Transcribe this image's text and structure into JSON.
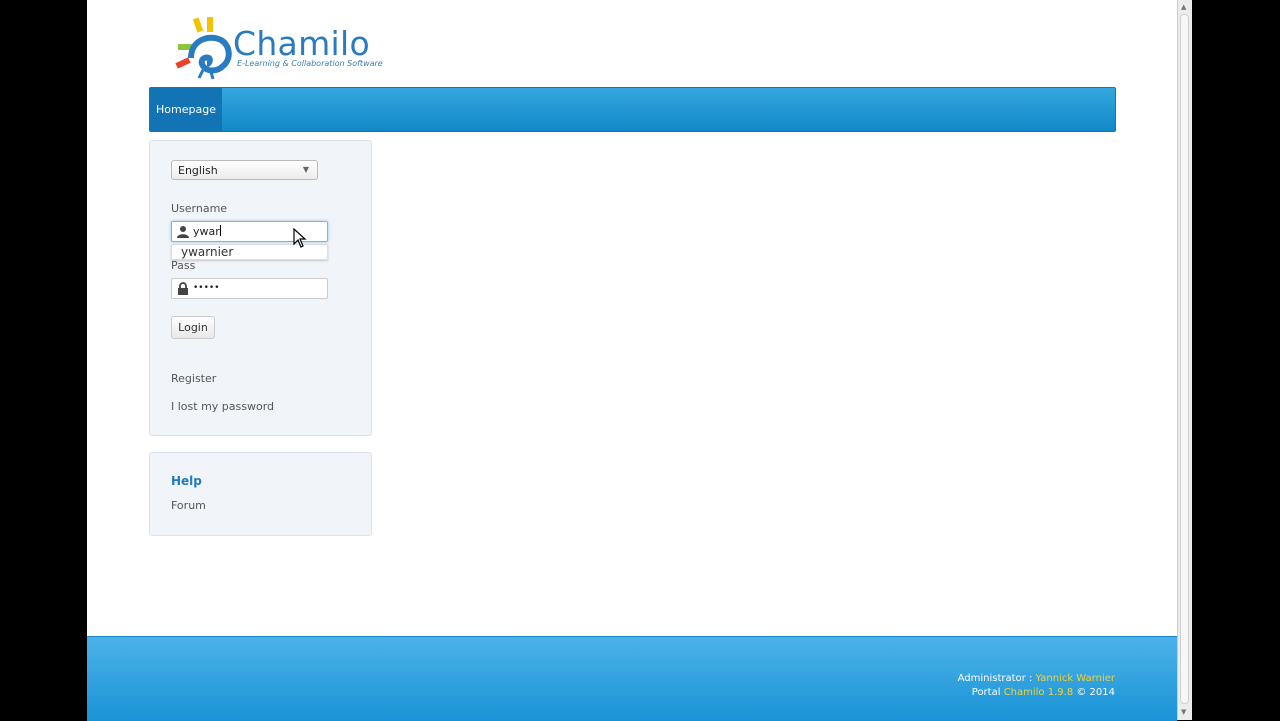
{
  "logo": {
    "title": "Chamilo",
    "subtitle": "E-Learning & Collaboration Software"
  },
  "nav": {
    "items": [
      {
        "label": "Homepage"
      }
    ]
  },
  "login": {
    "language": "English",
    "username_label": "Username",
    "username_value": "ywar",
    "autocomplete_suggestion": "ywarnier",
    "password_label": "Pass",
    "password_value": "•••••",
    "login_button": "Login",
    "register_link": "Register",
    "lost_password_link": "I lost my password"
  },
  "help": {
    "title": "Help",
    "forum_link": "Forum"
  },
  "footer": {
    "admin_label": "Administrator : ",
    "admin_name": "Yannick Warnier",
    "portal_label": "Portal ",
    "portal_name": "Chamilo 1.9.8",
    "copyright": " © 2014"
  },
  "colors": {
    "brand_blue": "#1288c8",
    "footer_highlight": "#f2d23a"
  }
}
